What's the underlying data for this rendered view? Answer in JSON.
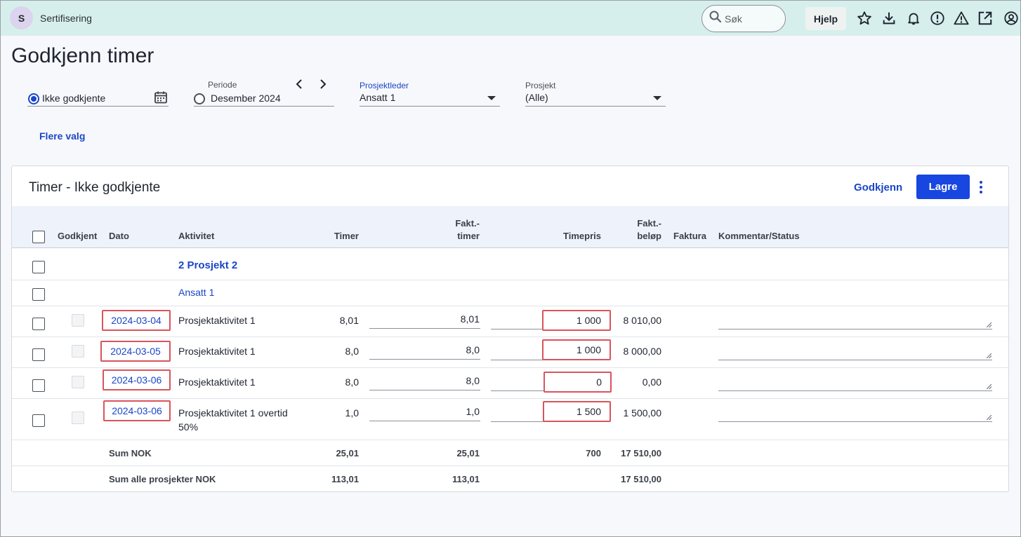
{
  "topbar": {
    "avatar_letter": "S",
    "app_name": "Sertifisering",
    "search_placeholder": "Søk",
    "help_label": "Hjelp",
    "icons": [
      "star-icon",
      "download-icon",
      "bell-icon",
      "alert-circle-icon",
      "warning-triangle-icon",
      "external-link-icon",
      "account-icon"
    ]
  },
  "page": {
    "title": "Godkjenn timer"
  },
  "filters": {
    "status_value": "Ikke godkjente",
    "period_label": "Periode",
    "period_value": "Desember 2024",
    "project_manager_label": "Prosjektleder",
    "project_manager_value": "Ansatt 1",
    "project_label": "Prosjekt",
    "project_value": "(Alle)",
    "more_options": "Flere valg"
  },
  "panel": {
    "title": "Timer - Ikke godkjente",
    "approve_label": "Godkjenn",
    "save_label": "Lagre"
  },
  "table": {
    "headers": {
      "approved": "Godkjent",
      "date": "Dato",
      "activity": "Aktivitet",
      "hours": "Timer",
      "billable_hours_1": "Fakt.-",
      "billable_hours_2": "timer",
      "hourly_rate": "Timepris",
      "billable_amount_1": "Fakt.-",
      "billable_amount_2": "beløp",
      "invoice": "Faktura",
      "comment": "Kommentar/Status"
    },
    "project_group": "2 Prosjekt 2",
    "employee_group": "Ansatt 1",
    "rows": [
      {
        "date": "2024-03-04",
        "activity": "Prosjektaktivitet 1",
        "activity_2": "",
        "hours": "8,01",
        "billable_hours": "8,01",
        "rate": "1 000",
        "amount": "8 010,00"
      },
      {
        "date": "2024-03-05",
        "activity": "Prosjektaktivitet 1",
        "activity_2": "",
        "hours": "8,0",
        "billable_hours": "8,0",
        "rate": "1 000",
        "amount": "8 000,00"
      },
      {
        "date": "2024-03-06",
        "activity": "Prosjektaktivitet 1",
        "activity_2": "",
        "hours": "8,0",
        "billable_hours": "8,0",
        "rate": "0",
        "amount": "0,00"
      },
      {
        "date": "2024-03-06",
        "activity": "Prosjektaktivitet 1 overtid",
        "activity_2": "50%",
        "hours": "1,0",
        "billable_hours": "1,0",
        "rate": "1 500",
        "amount": "1 500,00"
      }
    ],
    "sum": {
      "label": "Sum NOK",
      "hours": "25,01",
      "billable_hours": "25,01",
      "rate": "700",
      "amount": "17 510,00"
    },
    "sum_all": {
      "label": "Sum alle prosjekter NOK",
      "hours": "113,01",
      "billable_hours": "113,01",
      "amount": "17 510,00"
    }
  }
}
